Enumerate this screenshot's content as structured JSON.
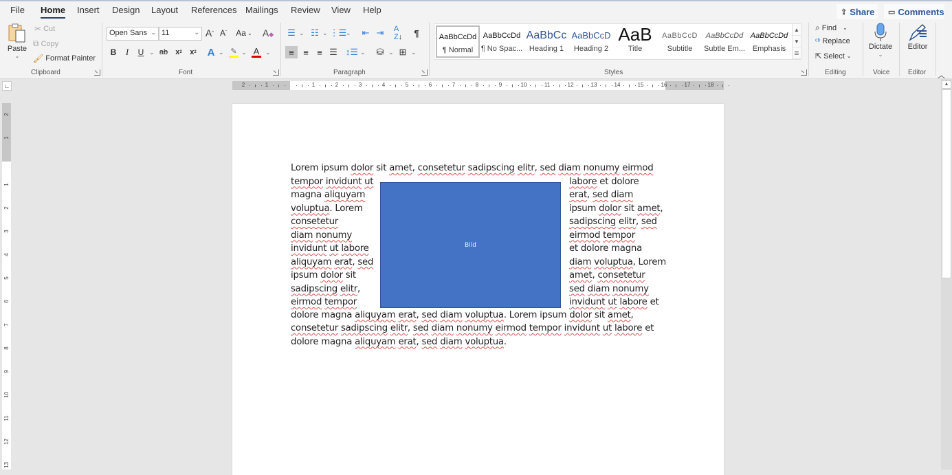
{
  "tabs": [
    "File",
    "Home",
    "Insert",
    "Design",
    "Layout",
    "References",
    "Mailings",
    "Review",
    "View",
    "Help"
  ],
  "active_tab": "Home",
  "share_label": "Share",
  "comments_label": "Comments",
  "clipboard": {
    "group_label": "Clipboard",
    "paste": "Paste",
    "cut": "Cut",
    "copy": "Copy",
    "format_painter": "Format Painter"
  },
  "font": {
    "group_label": "Font",
    "font_name": "Open Sans",
    "font_size": "11",
    "grow": "A",
    "shrink": "A",
    "change_case": "Aa",
    "bold": "B",
    "italic": "I",
    "underline": "U",
    "strike": "ab",
    "subscript": "x",
    "superscript": "x",
    "text_effects": "A",
    "font_color": "A",
    "highlight_color": "#ffff00",
    "font_color_value": "#e00000"
  },
  "paragraph": {
    "group_label": "Paragraph"
  },
  "styles": {
    "group_label": "Styles",
    "items": [
      {
        "preview": "AaBbCcDd",
        "name": "¶ Normal"
      },
      {
        "preview": "AaBbCcDd",
        "name": "¶ No Spac..."
      },
      {
        "preview": "AaBbCc",
        "name": "Heading 1"
      },
      {
        "preview": "AaBbCcD",
        "name": "Heading 2"
      },
      {
        "preview": "AaB",
        "name": "Title"
      },
      {
        "preview": "AaBbCcD",
        "name": "Subtitle"
      },
      {
        "preview": "AaBbCcDd",
        "name": "Subtle Em..."
      },
      {
        "preview": "AaBbCcDd",
        "name": "Emphasis"
      }
    ],
    "selected": "¶ Normal"
  },
  "editing": {
    "group_label": "Editing",
    "find": "Find",
    "replace": "Replace",
    "select": "Select"
  },
  "voice": {
    "group_label": "Voice",
    "dictate": "Dictate"
  },
  "editor": {
    "group_label": "Editor",
    "editor": "Editor"
  },
  "ruler": {
    "h_ticks": [
      "2",
      "1",
      "",
      "1",
      "2",
      "3",
      "4",
      "5",
      "6",
      "7",
      "8",
      "9",
      "10",
      "11",
      "12",
      "13",
      "14",
      "15",
      "16",
      "17",
      "18"
    ],
    "v_ticks": [
      "2",
      "1",
      "",
      "1",
      "2",
      "3",
      "4",
      "5",
      "6",
      "7",
      "8",
      "9",
      "10",
      "11",
      "12",
      "13"
    ]
  },
  "document": {
    "image_label": "Bild",
    "lines_full_top": [
      [
        [
          "Lorem ipsum ",
          false
        ],
        [
          "dolor",
          true
        ],
        [
          " sit ",
          false
        ],
        [
          "amet",
          true
        ],
        [
          ", ",
          false
        ],
        [
          "consetetur",
          true
        ],
        [
          " ",
          false
        ],
        [
          "sadipscing",
          true
        ],
        [
          " ",
          false
        ],
        [
          "elitr",
          true
        ],
        [
          ", ",
          false
        ],
        [
          "sed",
          true
        ],
        [
          " ",
          false
        ],
        [
          "diam",
          true
        ],
        [
          " ",
          false
        ],
        [
          "nonumy",
          true
        ],
        [
          " ",
          false
        ],
        [
          "eirmod",
          true
        ]
      ]
    ],
    "lines_left": [
      [
        [
          "tempor",
          true
        ],
        [
          " ",
          false
        ],
        [
          "invidunt",
          true
        ],
        [
          " ",
          false
        ],
        [
          "ut",
          true
        ]
      ],
      [
        [
          "magna ",
          false
        ],
        [
          "aliquyam",
          true
        ]
      ],
      [
        [
          "voluptua",
          true
        ],
        [
          ". Lorem",
          false
        ]
      ],
      [
        [
          "consetetur",
          true
        ]
      ],
      [
        [
          "diam",
          true
        ],
        [
          " ",
          false
        ],
        [
          "nonumy",
          true
        ]
      ],
      [
        [
          "invidunt",
          true
        ],
        [
          " ",
          false
        ],
        [
          "ut",
          true
        ],
        [
          " ",
          false
        ],
        [
          "labore",
          true
        ]
      ],
      [
        [
          "aliquyam",
          true
        ],
        [
          " ",
          false
        ],
        [
          "erat",
          true
        ],
        [
          ", ",
          false
        ],
        [
          "sed",
          true
        ]
      ],
      [
        [
          "ipsum ",
          false
        ],
        [
          "dolor",
          true
        ],
        [
          " sit",
          false
        ]
      ],
      [
        [
          "sadipscing",
          true
        ],
        [
          " ",
          false
        ],
        [
          "elitr",
          true
        ],
        [
          ",",
          false
        ]
      ],
      [
        [
          "eirmod",
          true
        ],
        [
          " ",
          false
        ],
        [
          "tempor",
          true
        ]
      ]
    ],
    "lines_right": [
      [
        [
          "labore",
          true
        ],
        [
          " et dolore",
          false
        ]
      ],
      [
        [
          "erat",
          true
        ],
        [
          ", ",
          false
        ],
        [
          "sed",
          true
        ],
        [
          " ",
          false
        ],
        [
          "diam",
          true
        ]
      ],
      [
        [
          "ipsum ",
          false
        ],
        [
          "dolor",
          true
        ],
        [
          " sit ",
          false
        ],
        [
          "amet",
          true
        ],
        [
          ",",
          false
        ]
      ],
      [
        [
          "sadipscing",
          true
        ],
        [
          " ",
          false
        ],
        [
          "elitr",
          true
        ],
        [
          ", ",
          false
        ],
        [
          "sed",
          true
        ]
      ],
      [
        [
          "eirmod",
          true
        ],
        [
          " ",
          false
        ],
        [
          "tempor",
          true
        ]
      ],
      [
        [
          "et dolore magna",
          false
        ]
      ],
      [
        [
          "diam",
          true
        ],
        [
          " ",
          false
        ],
        [
          "voluptua",
          true
        ],
        [
          ", Lorem",
          false
        ]
      ],
      [
        [
          "amet",
          true
        ],
        [
          ", ",
          false
        ],
        [
          "consetetur",
          true
        ]
      ],
      [
        [
          "sed",
          true
        ],
        [
          " ",
          false
        ],
        [
          "diam",
          true
        ],
        [
          " ",
          false
        ],
        [
          "nonumy",
          true
        ]
      ],
      [
        [
          "invidunt",
          true
        ],
        [
          " ",
          false
        ],
        [
          "ut",
          true
        ],
        [
          " ",
          false
        ],
        [
          "labore",
          true
        ],
        [
          " et",
          false
        ]
      ]
    ],
    "lines_full_bottom": [
      [
        [
          "dolore magna ",
          false
        ],
        [
          "aliquyam",
          true
        ],
        [
          " ",
          false
        ],
        [
          "erat",
          true
        ],
        [
          ", ",
          false
        ],
        [
          "sed",
          true
        ],
        [
          " ",
          false
        ],
        [
          "diam",
          true
        ],
        [
          " ",
          false
        ],
        [
          "voluptua",
          true
        ],
        [
          ". Lorem ipsum ",
          false
        ],
        [
          "dolor",
          true
        ],
        [
          " sit ",
          false
        ],
        [
          "amet",
          true
        ],
        [
          ",",
          false
        ]
      ],
      [
        [
          "consetetur",
          true
        ],
        [
          " ",
          false
        ],
        [
          "sadipscing",
          true
        ],
        [
          " ",
          false
        ],
        [
          "elitr",
          true
        ],
        [
          ", ",
          false
        ],
        [
          "sed",
          true
        ],
        [
          " ",
          false
        ],
        [
          "diam",
          true
        ],
        [
          " ",
          false
        ],
        [
          "nonumy",
          true
        ],
        [
          " ",
          false
        ],
        [
          "eirmod",
          true
        ],
        [
          " ",
          false
        ],
        [
          "tempor",
          true
        ],
        [
          " ",
          false
        ],
        [
          "invidunt",
          true
        ],
        [
          " ",
          false
        ],
        [
          "ut",
          true
        ],
        [
          " ",
          false
        ],
        [
          "labore",
          true
        ],
        [
          " et",
          false
        ]
      ],
      [
        [
          "dolore magna ",
          false
        ],
        [
          "aliquyam",
          true
        ],
        [
          " ",
          false
        ],
        [
          "erat",
          true
        ],
        [
          ", ",
          false
        ],
        [
          "sed",
          true
        ],
        [
          " ",
          false
        ],
        [
          "diam",
          true
        ],
        [
          " ",
          false
        ],
        [
          "voluptua",
          true
        ],
        [
          ".",
          false
        ]
      ]
    ]
  }
}
